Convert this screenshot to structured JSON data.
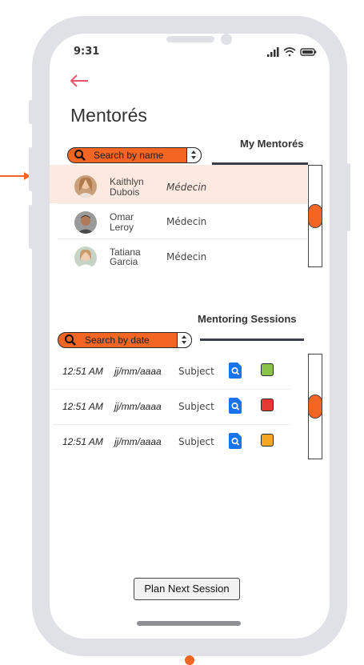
{
  "status_bar": {
    "time": "9:31"
  },
  "header": {
    "title": "Mentorés"
  },
  "mentores": {
    "tab_label": "My Mentorés",
    "search_placeholder": "Search by name",
    "items": [
      {
        "first": "Kaithlyn",
        "last": "Dubois",
        "role": "Médecin",
        "selected": true
      },
      {
        "first": "Omar",
        "last": "Leroy",
        "role": "Médecin",
        "selected": false
      },
      {
        "first": "Tatiana",
        "last": "Garcia",
        "role": "Médecin",
        "selected": false
      }
    ]
  },
  "sessions": {
    "tab_label": "Mentoring Sessions",
    "search_placeholder": "Search by date",
    "items": [
      {
        "time": "12:51 AM",
        "date": "jj/mm/aaaa",
        "subject": "Subject",
        "status_color": "#8bc34a"
      },
      {
        "time": "12:51 AM",
        "date": "jj/mm/aaaa",
        "subject": "Subject",
        "status_color": "#e53935"
      },
      {
        "time": "12:51 AM",
        "date": "jj/mm/aaaa",
        "subject": "Subject",
        "status_color": "#f5a623"
      }
    ]
  },
  "actions": {
    "plan_label": "Plan Next Session"
  },
  "colors": {
    "accent": "#f26522",
    "back_arrow": "#e8546a",
    "selected_row": "#fde9df",
    "view_icon": "#1a73e8"
  }
}
